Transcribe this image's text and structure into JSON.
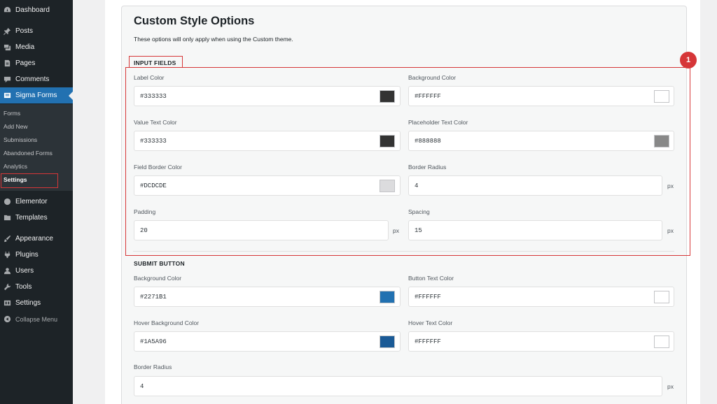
{
  "sidebar": {
    "items": [
      {
        "label": "Dashboard",
        "icon": "dashboard-icon"
      },
      {
        "label": "Posts",
        "icon": "pin-icon"
      },
      {
        "label": "Media",
        "icon": "media-icon"
      },
      {
        "label": "Pages",
        "icon": "pages-icon"
      },
      {
        "label": "Comments",
        "icon": "comment-icon"
      },
      {
        "label": "Sigma Forms",
        "icon": "forms-icon"
      },
      {
        "label": "Elementor",
        "icon": "elementor-icon"
      },
      {
        "label": "Templates",
        "icon": "folder-icon"
      },
      {
        "label": "Appearance",
        "icon": "brush-icon"
      },
      {
        "label": "Plugins",
        "icon": "plugin-icon"
      },
      {
        "label": "Users",
        "icon": "user-icon"
      },
      {
        "label": "Tools",
        "icon": "wrench-icon"
      },
      {
        "label": "Settings",
        "icon": "settings-icon"
      },
      {
        "label": "Collapse Menu",
        "icon": "collapse-icon"
      }
    ],
    "submenu": [
      "Forms",
      "Add New",
      "Submissions",
      "Abandoned Forms",
      "Analytics",
      "Settings"
    ]
  },
  "main": {
    "title": "Custom Style Options",
    "description": "These options will only apply when using the Custom theme.",
    "input_fields": {
      "heading": "INPUT FIELDS",
      "label_color": {
        "label": "Label Color",
        "value": "#333333",
        "swatch": "#333333"
      },
      "background_color": {
        "label": "Background Color",
        "value": "#FFFFFF",
        "swatch": "#FFFFFF"
      },
      "value_text_color": {
        "label": "Value Text Color",
        "value": "#333333",
        "swatch": "#333333"
      },
      "placeholder_text_color": {
        "label": "Placeholder Text Color",
        "value": "#888888",
        "swatch": "#888888"
      },
      "field_border_color": {
        "label": "Field Border Color",
        "value": "#DCDCDE",
        "swatch": "#DCDCDE"
      },
      "border_radius": {
        "label": "Border Radius",
        "value": "4",
        "unit": "px"
      },
      "padding": {
        "label": "Padding",
        "value": "20",
        "unit": "px"
      },
      "spacing": {
        "label": "Spacing",
        "value": "15",
        "unit": "px"
      }
    },
    "submit_button": {
      "heading": "SUBMIT BUTTON",
      "background_color": {
        "label": "Background Color",
        "value": "#2271B1",
        "swatch": "#2271B1"
      },
      "button_text_color": {
        "label": "Button Text Color",
        "value": "#FFFFFF",
        "swatch": "#FFFFFF"
      },
      "hover_background_color": {
        "label": "Hover Background Color",
        "value": "#1A5A96",
        "swatch": "#1A5A96"
      },
      "hover_text_color": {
        "label": "Hover Text Color",
        "value": "#FFFFFF",
        "swatch": "#FFFFFF"
      },
      "border_radius": {
        "label": "Border Radius",
        "value": "4",
        "unit": "px"
      }
    }
  },
  "annotation": {
    "badge": "1",
    "color": "#d63638"
  },
  "colors": {
    "sidebar_bg": "#1d2327",
    "active": "#2271b1"
  }
}
